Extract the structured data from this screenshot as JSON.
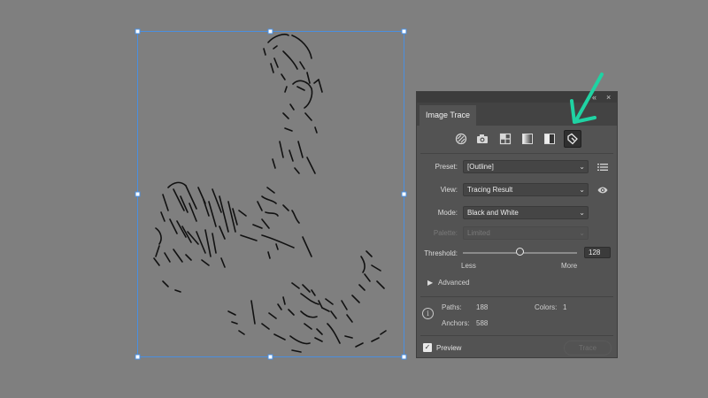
{
  "panel": {
    "tab_title": "Image Trace",
    "title_controls": {
      "collapse": "«",
      "close": "×"
    },
    "modes": [
      {
        "icon": "auto-color-icon",
        "active": false
      },
      {
        "icon": "high-color-icon",
        "active": false
      },
      {
        "icon": "low-color-icon",
        "active": false
      },
      {
        "icon": "grayscale-icon",
        "active": false
      },
      {
        "icon": "black-and-white-icon",
        "active": false
      },
      {
        "icon": "outline-icon",
        "active": true
      }
    ],
    "preset": {
      "label": "Preset:",
      "value": "[Outline]"
    },
    "view": {
      "label": "View:",
      "value": "Tracing Result"
    },
    "mode": {
      "label": "Mode:",
      "value": "Black and White"
    },
    "palette": {
      "label": "Palette:",
      "value": "Limited",
      "disabled": true
    },
    "threshold": {
      "label": "Threshold:",
      "value": "128",
      "min_label": "Less",
      "max_label": "More",
      "min": 0,
      "max": 255
    },
    "advanced": {
      "label": "Advanced",
      "expanded": false
    },
    "stats": {
      "paths_label": "Paths:",
      "paths": "188",
      "colors_label": "Colors:",
      "colors": "1",
      "anchors_label": "Anchors:",
      "anchors": "588"
    },
    "preview": {
      "label": "Preview",
      "checked": true
    },
    "trace_button": {
      "label": "Trace",
      "disabled": true
    }
  },
  "colors": {
    "canvas": "#7f7f7f",
    "panel_bg": "#535353",
    "selection": "#4a8fe0",
    "annotation_arrow": "#1fd3a3",
    "line_art": "#111111"
  }
}
